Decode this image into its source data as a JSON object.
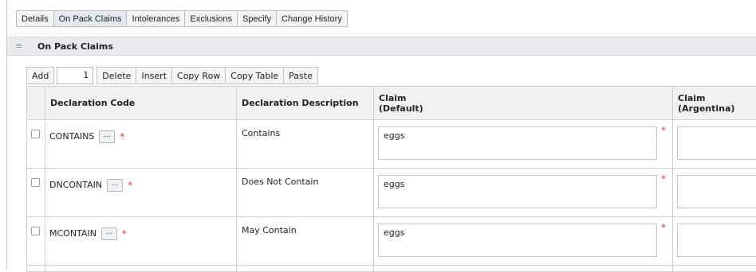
{
  "tabs": [
    {
      "label": "Details",
      "active": false
    },
    {
      "label": "On Pack Claims",
      "active": true
    },
    {
      "label": "Intolerances",
      "active": false
    },
    {
      "label": "Exclusions",
      "active": false
    },
    {
      "label": "Specify",
      "active": false
    },
    {
      "label": "Change History",
      "active": false
    }
  ],
  "section": {
    "collapse_icon": "collapse-icon",
    "title": "On Pack Claims"
  },
  "toolbar": {
    "add_label": "Add",
    "add_count": "1",
    "delete_label": "Delete",
    "insert_label": "Insert",
    "copy_row_label": "Copy Row",
    "copy_table_label": "Copy Table",
    "paste_label": "Paste"
  },
  "grid": {
    "headers": {
      "code": "Declaration Code",
      "description": "Declaration Description",
      "claim_default": "Claim\n(Default)",
      "claim_argentina": "Claim\n(Argentina)"
    },
    "rows": [
      {
        "code": "CONTAINS",
        "description": "Contains",
        "claim_default": "eggs",
        "claim_argentina": ""
      },
      {
        "code": "DNCONTAIN",
        "description": "Does Not Contain",
        "claim_default": "eggs",
        "claim_argentina": ""
      },
      {
        "code": "MCONTAIN",
        "description": "May Contain",
        "claim_default": "eggs",
        "claim_argentina": ""
      }
    ],
    "ellipsis_label": "...",
    "required_marker": "*"
  },
  "colors": {
    "required": "#d93b3b",
    "header_bg": "#f1f1f1",
    "section_bg": "#e8eaed",
    "active_tab": "#e3e9f2"
  }
}
